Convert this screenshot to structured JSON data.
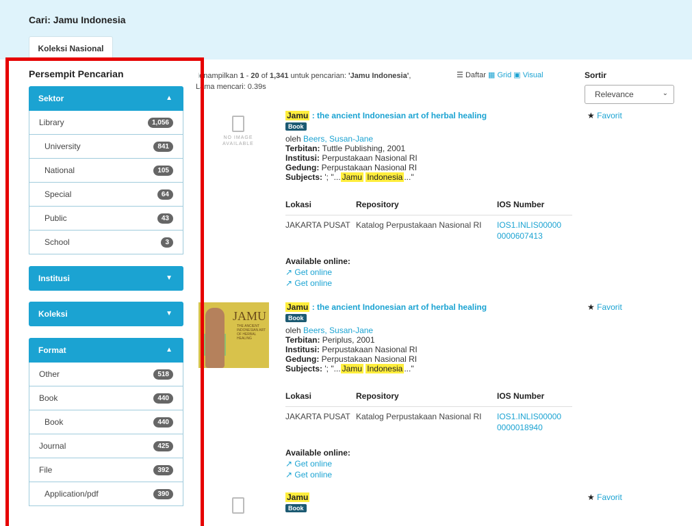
{
  "header": {
    "title": "Cari: Jamu Indonesia",
    "tab": "Koleksi Nasional"
  },
  "sidebar": {
    "title": "Persempit Pencarian",
    "sektor": {
      "label": "Sektor",
      "items": [
        {
          "label": "Library",
          "count": "1,056"
        },
        {
          "label": "University",
          "count": "841"
        },
        {
          "label": "National",
          "count": "105"
        },
        {
          "label": "Special",
          "count": "64"
        },
        {
          "label": "Public",
          "count": "43"
        },
        {
          "label": "School",
          "count": "3"
        }
      ]
    },
    "institusi": {
      "label": "Institusi"
    },
    "koleksi": {
      "label": "Koleksi"
    },
    "format": {
      "label": "Format",
      "items": [
        {
          "label": "Other",
          "count": "518"
        },
        {
          "label": "Book",
          "count": "440"
        },
        {
          "label": "Book",
          "count": "440"
        },
        {
          "label": "Journal",
          "count": "425"
        },
        {
          "label": "File",
          "count": "392"
        },
        {
          "label": "Application/pdf",
          "count": "390"
        }
      ]
    }
  },
  "results": {
    "summary_prefix": "Menampilkan",
    "from": "1",
    "to": "20",
    "of": "of",
    "total": "1,341",
    "for_text": "untuk pencarian:",
    "query": "'Jamu Indonesia'",
    "time_text": "Lama mencari: 0.39s",
    "views": {
      "daftar": "Daftar",
      "grid": "Grid",
      "visual": "Visual"
    },
    "sort_label": "Sortir",
    "sort_value": "Relevance",
    "no_image": "NO IMAGE AVAILABLE",
    "records": [
      {
        "title_hl": "Jamu",
        "title_rest": ": the ancient Indonesian art of herbal healing",
        "type": "Book",
        "by": "oleh",
        "author": "Beers, Susan-Jane",
        "terbitan_label": "Terbitan:",
        "terbitan": "Tuttle Publishing, 2001",
        "institusi_label": "Institusi:",
        "institusi": "Perpustakaan Nasional RI",
        "gedung_label": "Gedung:",
        "gedung": "Perpustakaan Nasional RI",
        "subjects_label": "Subjects:",
        "subjects_pre": "'; \"...",
        "subjects_hl1": "Jamu",
        "subjects_hl2": "Indonesia",
        "subjects_post": "...\"",
        "col_lokasi": "Lokasi",
        "col_repo": "Repository",
        "col_ios": "IOS Number",
        "lokasi": "JAKARTA PUSAT",
        "repository": "Katalog Perpustakaan Nasional RI",
        "ios1": "IOS1.INLIS00000",
        "ios2": "0000607413",
        "available": "Available online:",
        "get1": "Get online",
        "get2": "Get online",
        "favorit": "Favorit"
      },
      {
        "title_hl": "Jamu",
        "title_rest": ": the ancient Indonesian art of herbal healing",
        "type": "Book",
        "by": "oleh",
        "author": "Beers, Susan-Jane",
        "terbitan_label": "Terbitan:",
        "terbitan": "Periplus, 2001",
        "institusi_label": "Institusi:",
        "institusi": "Perpustakaan Nasional RI",
        "gedung_label": "Gedung:",
        "gedung": "Perpustakaan Nasional RI",
        "subjects_label": "Subjects:",
        "subjects_pre": "'; \"...",
        "subjects_hl1": "Jamu",
        "subjects_hl2": "Indonesia",
        "subjects_post": "...\"",
        "col_lokasi": "Lokasi",
        "col_repo": "Repository",
        "col_ios": "IOS Number",
        "lokasi": "JAKARTA PUSAT",
        "repository": "Katalog Perpustakaan Nasional RI",
        "ios1": "IOS1.INLIS00000",
        "ios2": "0000018940",
        "available": "Available online:",
        "get1": "Get online",
        "get2": "Get online",
        "favorit": "Favorit",
        "cover_title": "JAMU",
        "cover_sub": "THE ANCIENT INDONESIAN ART OF HERBAL HEALING"
      },
      {
        "title_hl": "Jamu",
        "type": "Book",
        "favorit": "Favorit"
      }
    ]
  },
  "colors": {
    "accent": "#1ba3d2",
    "banner": "#dff3fb",
    "highlight": "#ffee3d",
    "annotation": "#e60000"
  }
}
